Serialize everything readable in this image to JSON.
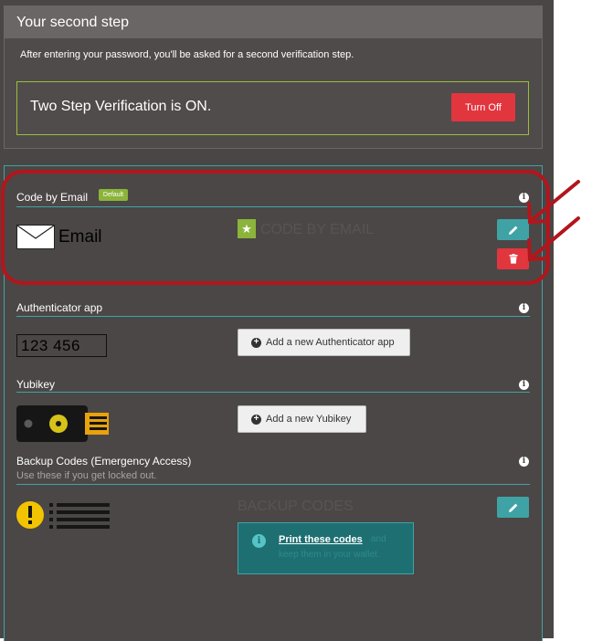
{
  "step": {
    "header": "Your second step",
    "description": "After entering your password, you'll be asked for a second verification step.",
    "status": "Two Step Verification is ON.",
    "turn_off_label": "Turn Off"
  },
  "methods": {
    "email": {
      "title": "Code by Email",
      "badge": "Default",
      "icon_label": "Email",
      "code_label": "CODE BY EMAIL",
      "edit_icon": "pencil-icon",
      "delete_icon": "trash-icon"
    },
    "authenticator": {
      "title": "Authenticator app",
      "sample_code": "123 456",
      "add_label": "Add a new Authenticator app"
    },
    "yubikey": {
      "title": "Yubikey",
      "add_label": "Add a new Yubikey"
    },
    "backup": {
      "title": "Backup Codes (Emergency Access)",
      "subtitle": "Use these if you get locked out.",
      "code_label": "BACKUP CODES",
      "print_link": "Print these codes",
      "print_rest": "and",
      "print_line2": "keep them in your wallet."
    }
  },
  "colors": {
    "background": "#4a4645",
    "accent_teal": "#3fa3a5",
    "danger_red": "#e2363f",
    "default_green": "#8bb43a",
    "annotation_red": "#b3151c"
  }
}
